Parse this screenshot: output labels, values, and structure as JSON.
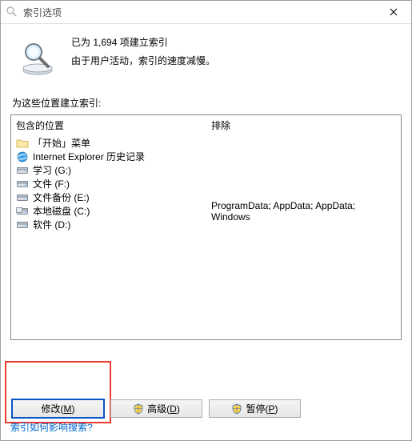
{
  "window": {
    "title": "索引选项"
  },
  "status": {
    "line1": "已为 1,694 项建立索引",
    "line2": "由于用户活动，索引的速度减慢。"
  },
  "section_label": "为这些位置建立索引:",
  "columns": {
    "included_header": "包含的位置",
    "excluded_header": "排除"
  },
  "locations": [
    {
      "icon": "folder",
      "label": "「开始」菜单",
      "exclude": ""
    },
    {
      "icon": "ie",
      "label": "Internet Explorer 历史记录",
      "exclude": ""
    },
    {
      "icon": "drive",
      "label": "学习 (G:)",
      "exclude": ""
    },
    {
      "icon": "drive",
      "label": "文件 (F:)",
      "exclude": ""
    },
    {
      "icon": "drive",
      "label": "文件备份 (E:)",
      "exclude": ""
    },
    {
      "icon": "drive-c",
      "label": "本地磁盘 (C:)",
      "exclude": "ProgramData; AppData; AppData; Windows"
    },
    {
      "icon": "drive",
      "label": "软件 (D:)",
      "exclude": ""
    }
  ],
  "buttons": {
    "modify": "修改(M)",
    "advanced": "高级(D)",
    "pause": "暂停(P)"
  },
  "help_link": "索引如何影响搜索?"
}
